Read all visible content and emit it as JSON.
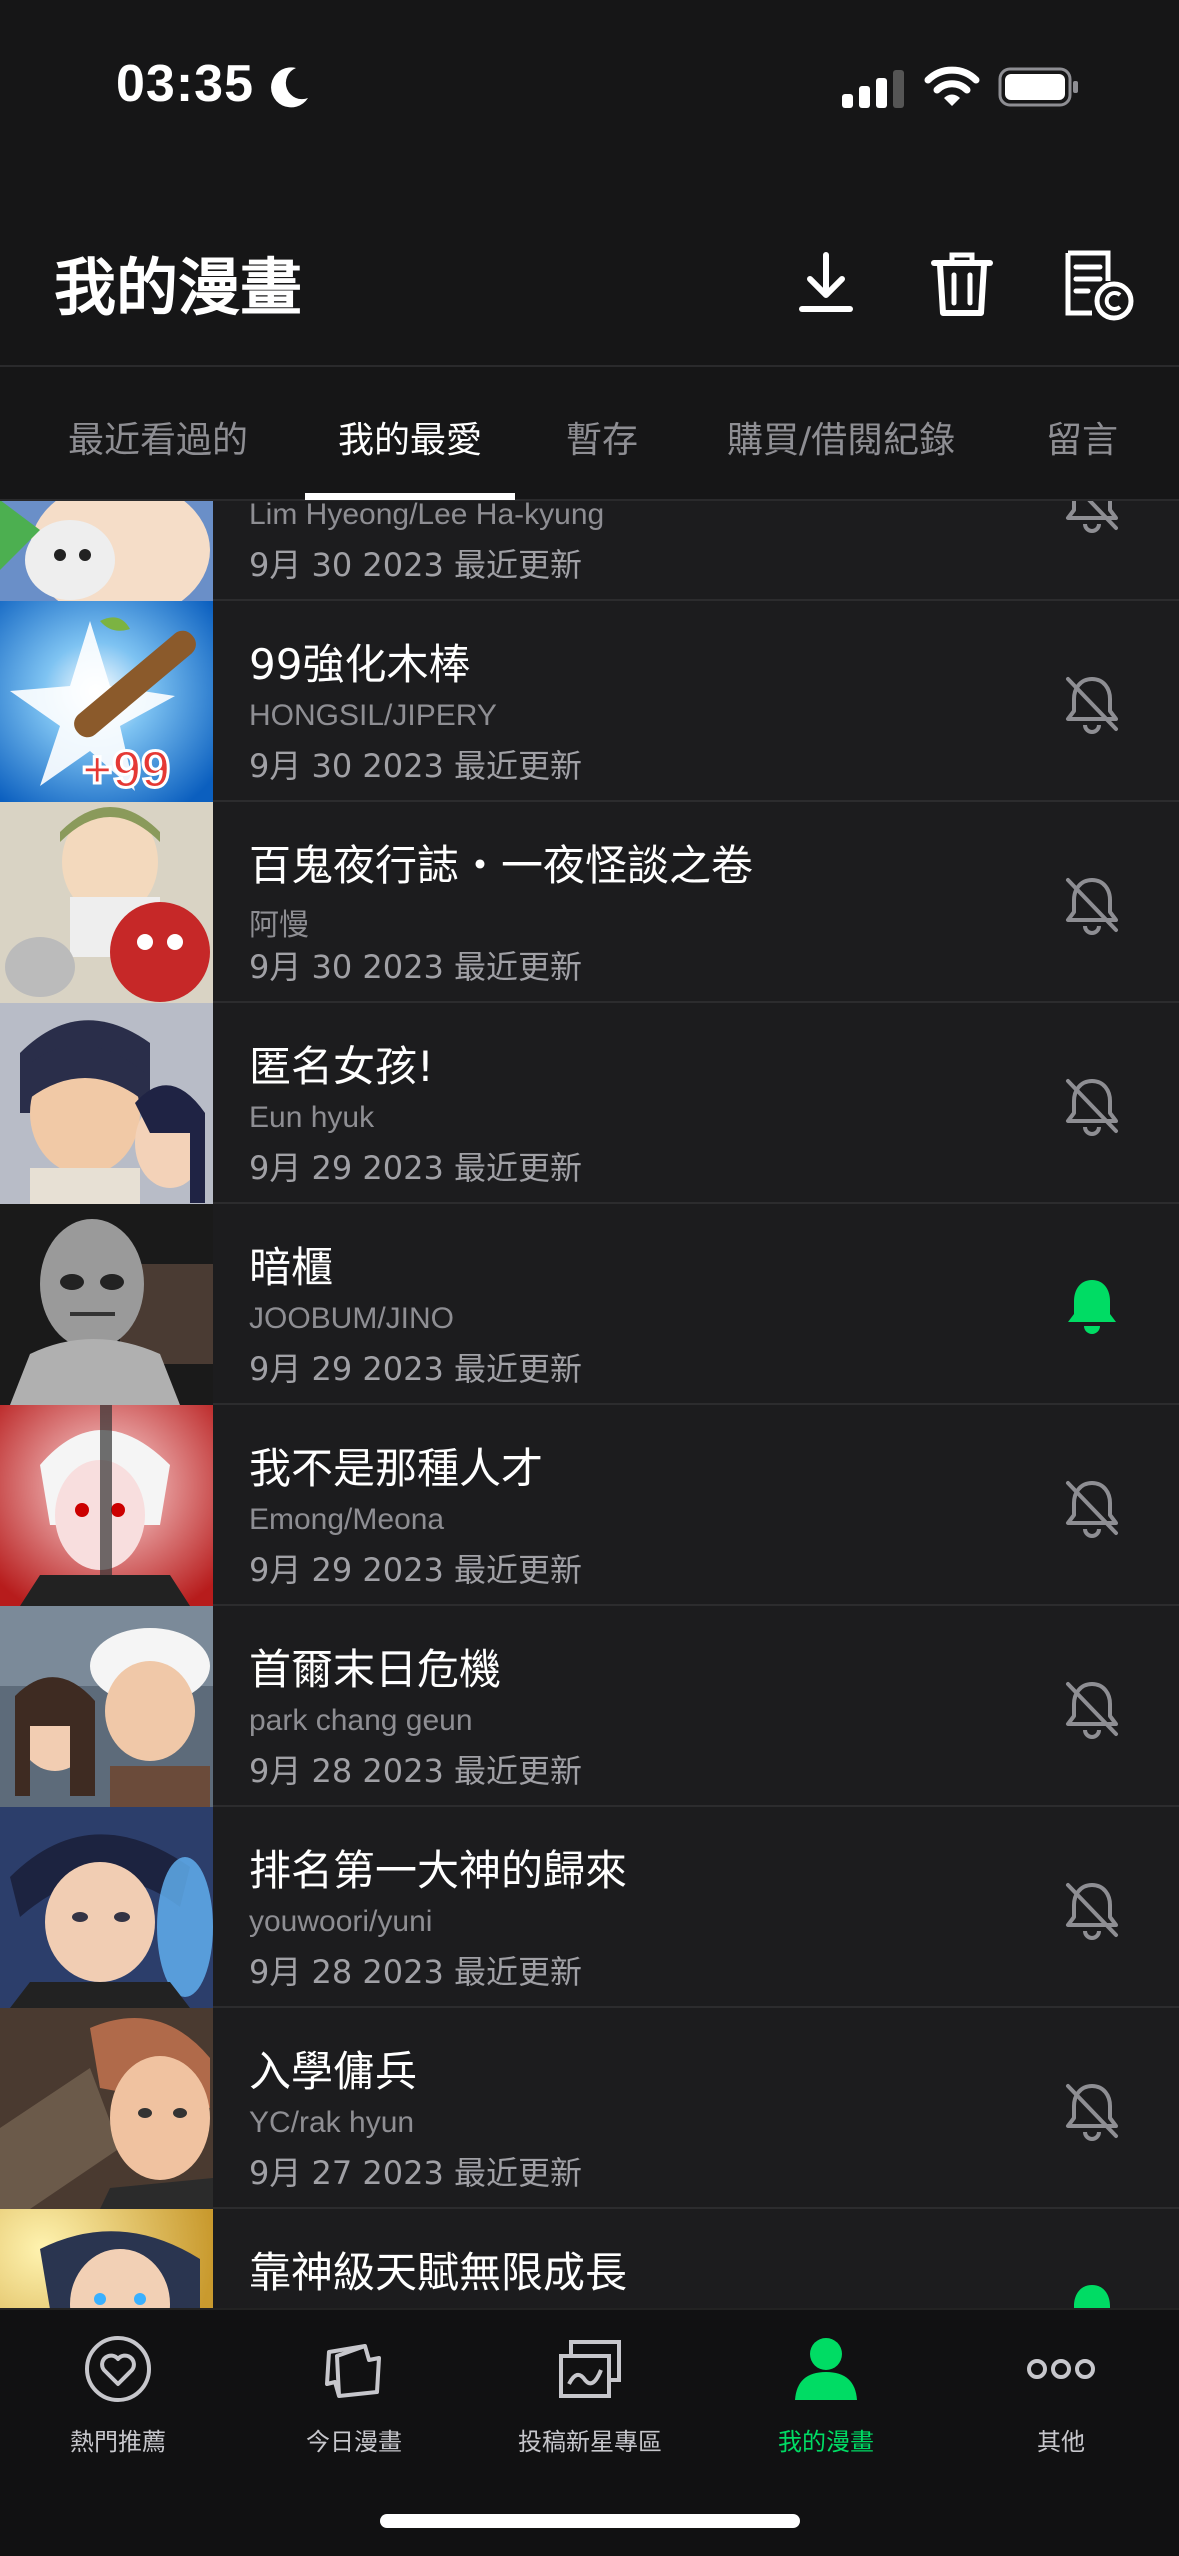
{
  "status_bar": {
    "time": "03:35"
  },
  "header": {
    "title": "我的漫畫"
  },
  "tabs": [
    {
      "label": "最近看過的"
    },
    {
      "label": "我的最愛"
    },
    {
      "label": "暫存"
    },
    {
      "label": "購買/借閱紀錄"
    },
    {
      "label": "留言"
    }
  ],
  "colors": {
    "accent": "#00dc64",
    "background": "#1c1c1e"
  },
  "list": [
    {
      "title": "",
      "author": "Lim Hyeong/Lee Ha-kyung",
      "date": "9月 30 2023 最近更新",
      "bell_on": false
    },
    {
      "title": "99強化木棒",
      "author": "HONGSIL/JIPERY",
      "date": "9月 30 2023 最近更新",
      "bell_on": false,
      "thumb_text": "+99"
    },
    {
      "title": "百鬼夜行誌・一夜怪談之卷",
      "author": "阿慢",
      "date": "9月 30 2023 最近更新",
      "bell_on": false
    },
    {
      "title": "匿名女孩!",
      "author": "Eun hyuk",
      "date": "9月 29 2023 最近更新",
      "bell_on": false
    },
    {
      "title": "暗櫃",
      "author": "JOOBUM/JINO",
      "date": "9月 29 2023 最近更新",
      "bell_on": true
    },
    {
      "title": "我不是那種人才",
      "author": "Emong/Meona",
      "date": "9月 29 2023 最近更新",
      "bell_on": false
    },
    {
      "title": "首爾末日危機",
      "author": "park chang geun",
      "date": "9月 28 2023 最近更新",
      "bell_on": false
    },
    {
      "title": "排名第一大神的歸來",
      "author": "youwoori/yuni",
      "date": "9月 28 2023 最近更新",
      "bell_on": false
    },
    {
      "title": "入學傭兵",
      "author": "YC/rak hyun",
      "date": "9月 27 2023 最近更新",
      "bell_on": false
    },
    {
      "title": "靠神級天賦無限成長",
      "author": "",
      "date": "",
      "bell_on": true
    }
  ],
  "bottom_nav": [
    {
      "label": "熱門推薦",
      "icon": "heart-icon"
    },
    {
      "label": "今日漫畫",
      "icon": "pages-icon"
    },
    {
      "label": "投稿新星專區",
      "icon": "gallery-icon"
    },
    {
      "label": "我的漫畫",
      "icon": "person-icon",
      "active": true
    },
    {
      "label": "其他",
      "icon": "more-icon"
    }
  ]
}
